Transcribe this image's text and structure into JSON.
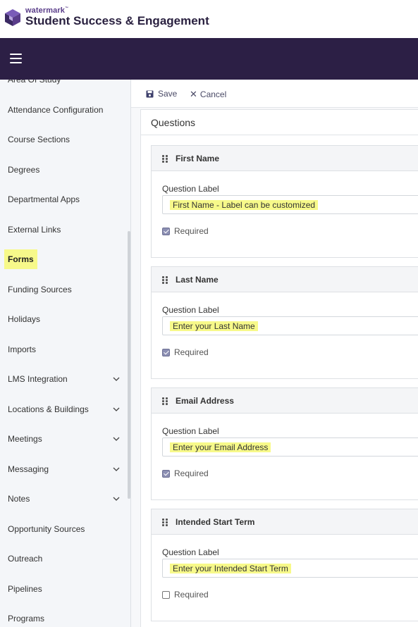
{
  "brand": {
    "small": "watermark",
    "tm": "™",
    "title": "Student Success & Engagement"
  },
  "sidebar": {
    "items": [
      {
        "label": "Area Of Study",
        "expandable": false
      },
      {
        "label": "Attendance Configuration",
        "expandable": false
      },
      {
        "label": "Course Sections",
        "expandable": false
      },
      {
        "label": "Degrees",
        "expandable": false
      },
      {
        "label": "Departmental Apps",
        "expandable": false
      },
      {
        "label": "External Links",
        "expandable": false
      },
      {
        "label": "Forms",
        "expandable": false,
        "active": true
      },
      {
        "label": "Funding Sources",
        "expandable": false
      },
      {
        "label": "Holidays",
        "expandable": false
      },
      {
        "label": "Imports",
        "expandable": false
      },
      {
        "label": "LMS Integration",
        "expandable": true
      },
      {
        "label": "Locations & Buildings",
        "expandable": true
      },
      {
        "label": "Meetings",
        "expandable": true
      },
      {
        "label": "Messaging",
        "expandable": true
      },
      {
        "label": "Notes",
        "expandable": true
      },
      {
        "label": "Opportunity Sources",
        "expandable": false
      },
      {
        "label": "Outreach",
        "expandable": false
      },
      {
        "label": "Pipelines",
        "expandable": false
      },
      {
        "label": "Programs",
        "expandable": false
      }
    ]
  },
  "toolbar": {
    "save_label": "Save",
    "cancel_label": "Cancel"
  },
  "main": {
    "title": "Questions",
    "questions": [
      {
        "title": "First Name",
        "label_caption": "Question Label",
        "value": "First Name - Label can be customized",
        "required_label": "Required",
        "required": true
      },
      {
        "title": "Last Name",
        "label_caption": "Question Label",
        "value": "Enter your Last Name",
        "required_label": "Required",
        "required": true
      },
      {
        "title": "Email Address",
        "label_caption": "Question Label",
        "value": "Enter your Email Address",
        "required_label": "Required",
        "required": true
      },
      {
        "title": "Intended Start Term",
        "label_caption": "Question Label",
        "value": "Enter your Intended Start Term",
        "required_label": "Required",
        "required": false
      }
    ]
  },
  "colors": {
    "topbar": "#2c1f45",
    "highlight": "#f7f98a",
    "brand_purple": "#5a3d8a"
  }
}
